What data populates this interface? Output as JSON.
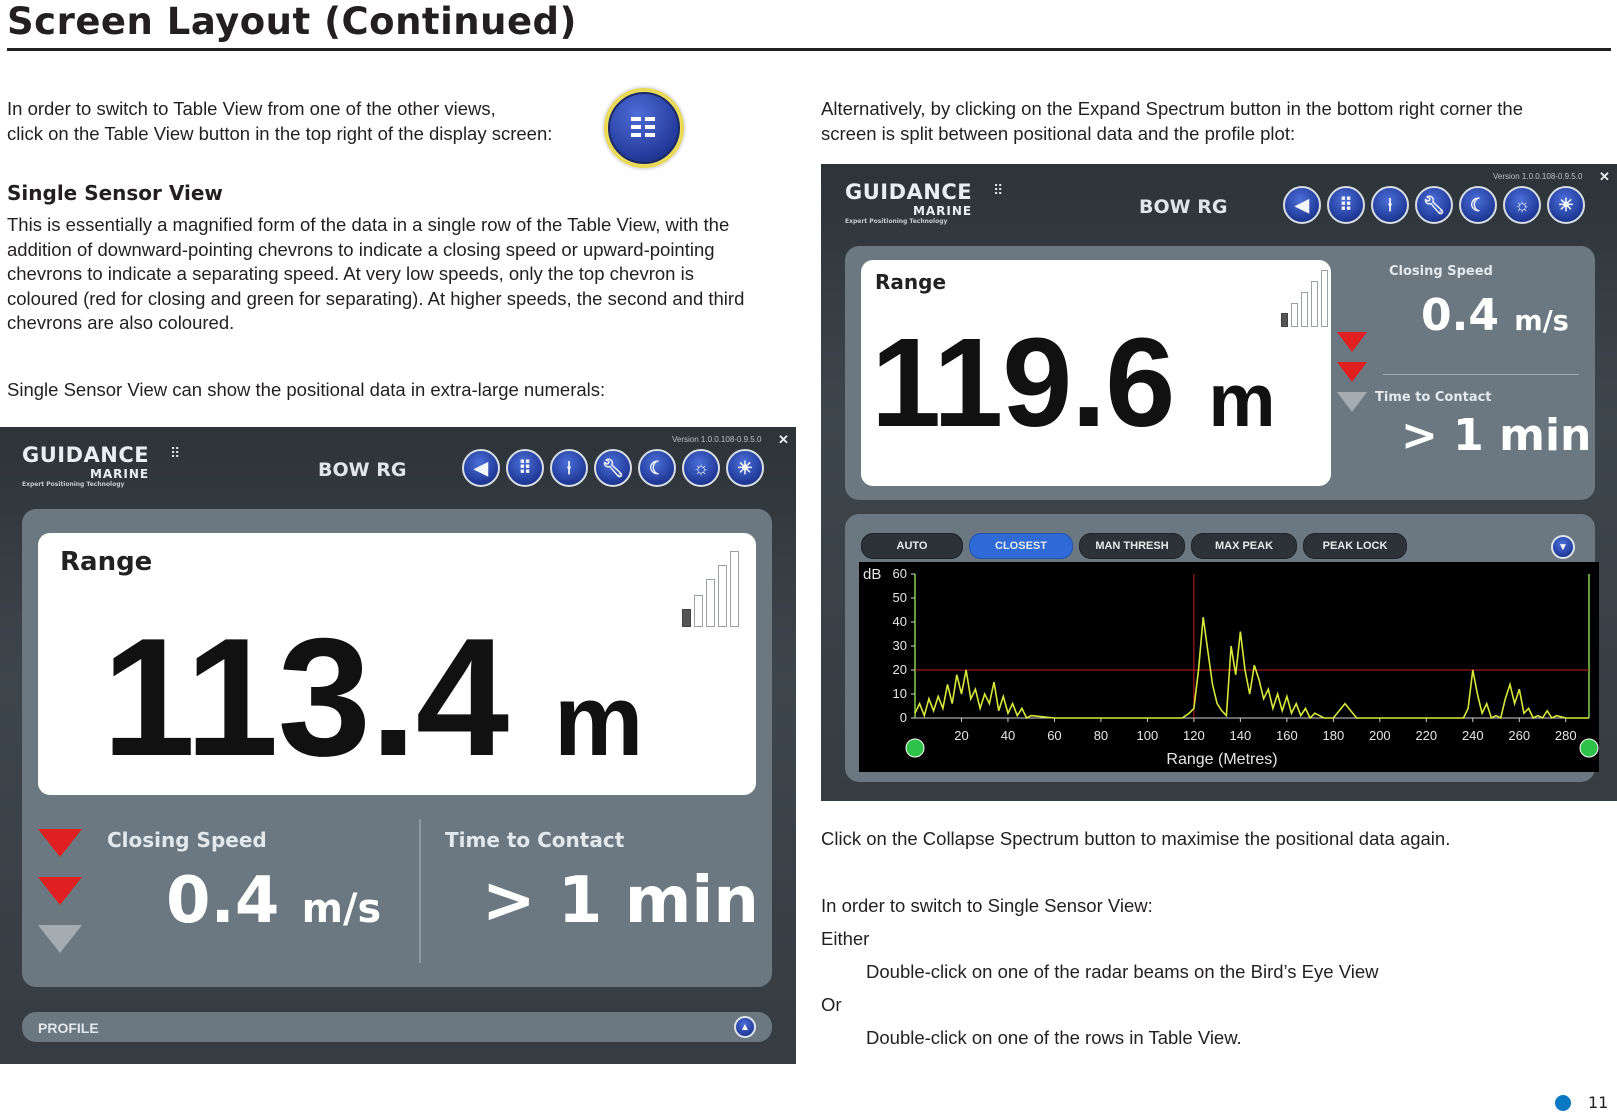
{
  "page": {
    "title": "Screen Layout (Continued)",
    "page_number": "11"
  },
  "left": {
    "intro_line1": "In order to switch to Table View from one of the other views,",
    "intro_line2": "click on the Table View button in the top right of the display screen:",
    "heading": "Single Sensor View",
    "para1_lines": [
      "This is essentially a magnified form of the data in a single row of the Table View, with the",
      "addition of downward-pointing chevrons to indicate a closing speed or upward-pointing",
      "chevrons to indicate a separating speed.  At very low speeds, only the top chevron is",
      "coloured (red for closing and green for separating). At higher speeds, the second and third",
      "chevrons are also coloured."
    ],
    "para2": "Single Sensor View can show the positional data in extra-large numerals:"
  },
  "right": {
    "intro_line1": "Alternatively, by clicking on the Expand Spectrum button in the bottom right corner the",
    "intro_line2": "screen is split between positional data and the profile plot:",
    "collapse_text": "Click on the Collapse Spectrum button to maximise the positional data again.",
    "switch_text": "In order to switch to Single Sensor View:",
    "either": "Either",
    "option1": "Double-click on one of the radar beams on the Bird’s Eye View",
    "or": "Or",
    "option2": "Double-click on one of the rows in Table View."
  },
  "screen1": {
    "logo_main": "GUIDANCE",
    "logo_sub": "MARINE",
    "logo_tag": "Expert Positioning Technology",
    "sensor_name": "BOW RG",
    "version": "Version 1.0.0.108-0.9.5.0",
    "close": "✕",
    "range_label": "Range",
    "range_value": "113.4",
    "range_unit": "m",
    "closing_label": "Closing Speed",
    "closing_value": "0.4",
    "closing_unit": "m/s",
    "contact_label": "Time to Contact",
    "contact_value": "> 1 min",
    "profile_label": "PROFILE"
  },
  "screen2": {
    "logo_main": "GUIDANCE",
    "logo_sub": "MARINE",
    "logo_tag": "Expert Positioning Technology",
    "sensor_name": "BOW RG",
    "version": "Version 1.0.0.108-0.9.5.0",
    "close": "✕",
    "range_label": "Range",
    "range_value": "119.6",
    "range_unit": "m",
    "closing_label": "Closing Speed",
    "closing_value": "0.4",
    "closing_unit": "m/s",
    "contact_label": "Time to Contact",
    "contact_value": "> 1 min",
    "modes": [
      "AUTO",
      "CLOSEST",
      "MAN THRESH",
      "MAX PEAK",
      "PEAK LOCK"
    ],
    "active_mode": "CLOSEST"
  },
  "icons": [
    "back-arrow-icon",
    "table-view-icon",
    "beacon-icon",
    "wrench-icon",
    "night-mode-icon",
    "brightness-down-icon",
    "brightness-up-icon"
  ],
  "colors": {
    "closing_chevron": "#e02020",
    "inactive_chevron": "#a5acb1",
    "button_blue": "#2f6ad6",
    "trace": "#d7e83a",
    "threshold": "#c81e1e",
    "page_dot": "#0a78c2"
  },
  "chart_data": {
    "type": "line",
    "title": "",
    "xlabel": "Range (Metres)",
    "ylabel": "dB",
    "xlim": [
      0,
      290
    ],
    "ylim": [
      0,
      60
    ],
    "xticks": [
      20,
      40,
      60,
      80,
      100,
      120,
      140,
      160,
      180,
      200,
      220,
      240,
      260,
      280
    ],
    "yticks": [
      0,
      10,
      20,
      30,
      40,
      50,
      60
    ],
    "threshold_db": 20,
    "marker_x": 120,
    "series": [
      {
        "x": [
          0,
          2,
          4,
          6,
          8,
          10,
          12,
          14,
          16,
          18,
          20,
          22,
          24,
          26,
          28,
          30,
          32,
          34,
          36,
          38,
          40,
          42,
          44,
          46,
          48,
          50,
          60,
          80,
          100,
          110,
          115,
          118,
          120,
          122,
          124,
          126,
          128,
          130,
          132,
          134,
          136,
          138,
          140,
          142,
          144,
          146,
          148,
          150,
          152,
          154,
          156,
          158,
          160,
          162,
          164,
          166,
          168,
          170,
          172,
          174,
          176,
          178,
          180,
          185,
          190,
          200,
          210,
          220,
          230,
          236,
          238,
          240,
          242,
          244,
          246,
          248,
          250,
          252,
          254,
          256,
          258,
          260,
          262,
          264,
          266,
          268,
          270,
          272,
          274,
          276,
          280,
          290
        ],
        "y": [
          2,
          6,
          1,
          8,
          3,
          9,
          4,
          14,
          6,
          18,
          10,
          20,
          8,
          12,
          4,
          10,
          6,
          15,
          3,
          9,
          2,
          6,
          1,
          4,
          0,
          1,
          0,
          0,
          0,
          0,
          0,
          2,
          4,
          20,
          42,
          28,
          14,
          6,
          3,
          1,
          30,
          18,
          36,
          20,
          10,
          22,
          16,
          8,
          12,
          4,
          10,
          3,
          9,
          2,
          6,
          1,
          4,
          0,
          2,
          1,
          0,
          0,
          0,
          6,
          0,
          0,
          0,
          0,
          0,
          0,
          4,
          20,
          10,
          2,
          6,
          0,
          1,
          0,
          8,
          14,
          6,
          12,
          2,
          4,
          0,
          1,
          0,
          3,
          0,
          1,
          0,
          0
        ]
      }
    ]
  }
}
